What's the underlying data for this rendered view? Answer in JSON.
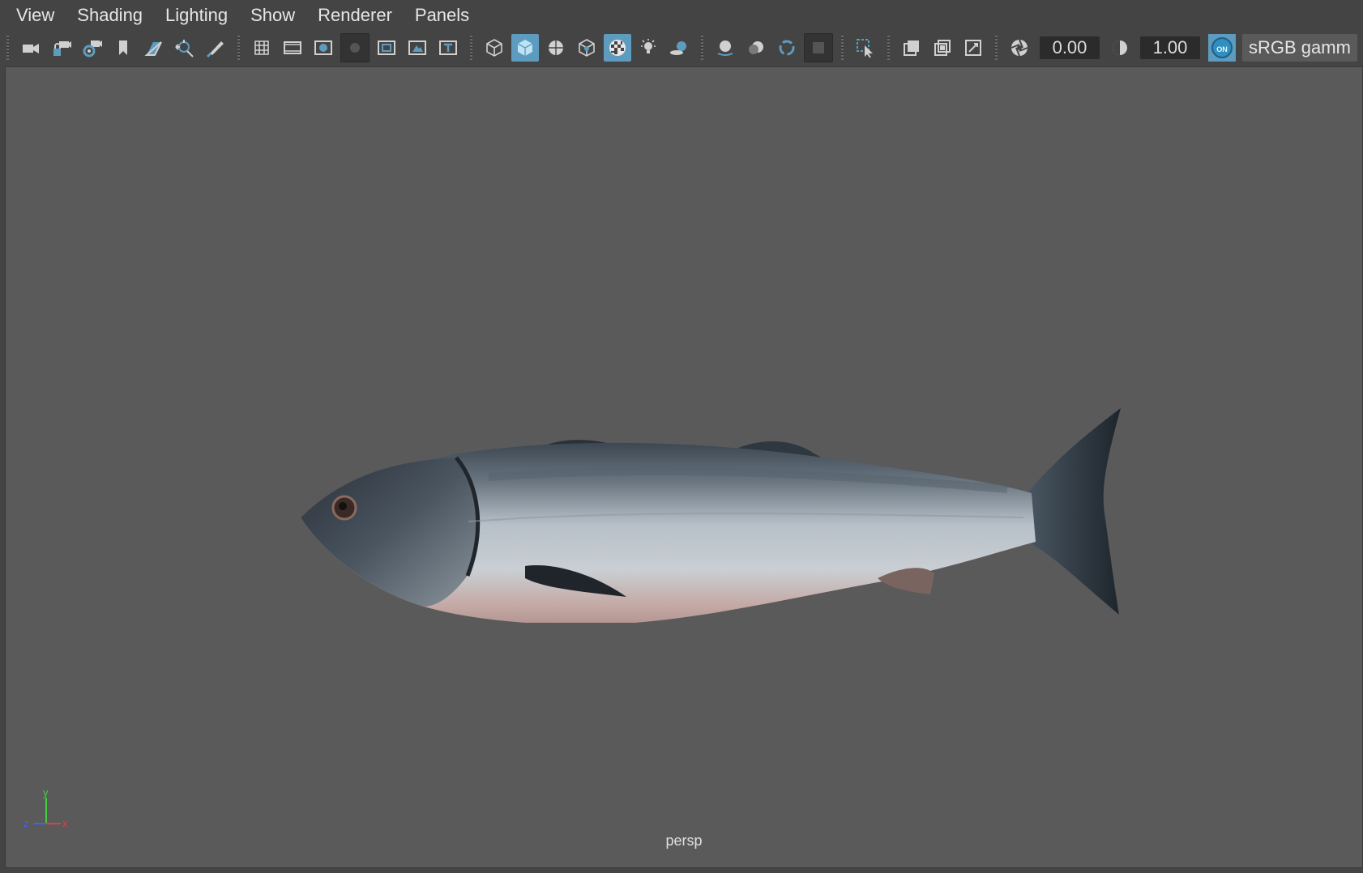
{
  "menubar": {
    "items": [
      "View",
      "Shading",
      "Lighting",
      "Show",
      "Renderer",
      "Panels"
    ]
  },
  "toolbar": {
    "exposure_value": "0.00",
    "gamma_value": "1.00",
    "color_management_badge": "ON",
    "color_space_label": "sRGB gamm",
    "icons": [
      "select-camera-icon",
      "lock-camera-icon",
      "camera-attributes-icon",
      "bookmark-icon",
      "image-plane-icon",
      "2d-pan-zoom-icon",
      "grease-pencil-icon",
      "grid-icon",
      "film-gate-icon",
      "resolution-gate-icon",
      "gate-mask-icon",
      "field-chart-icon",
      "safe-action-icon",
      "safe-title-icon",
      "wireframe-icon",
      "smooth-shade-icon",
      "wireframe-on-shaded-icon",
      "xray-icon",
      "textured-icon",
      "use-all-lights-icon",
      "shadows-icon",
      "screen-space-ao-icon",
      "motion-blur-icon",
      "multisample-aa-icon",
      "depth-of-field-icon",
      "isolate-select-icon",
      "xray-active-icon",
      "xray-joints-icon",
      "backface-culling-icon",
      "exposure-icon",
      "gamma-icon"
    ]
  },
  "viewport": {
    "camera": "persp",
    "axis_labels": {
      "y": "y",
      "z": "z",
      "x": "x"
    },
    "object": "salmon fish model"
  },
  "colors": {
    "ui_background": "#444444",
    "viewport_background": "#5a5a5a",
    "active_button": "#5d9cbf",
    "axis_x": "#e04040",
    "axis_y": "#40d040",
    "axis_z": "#4060ff"
  }
}
